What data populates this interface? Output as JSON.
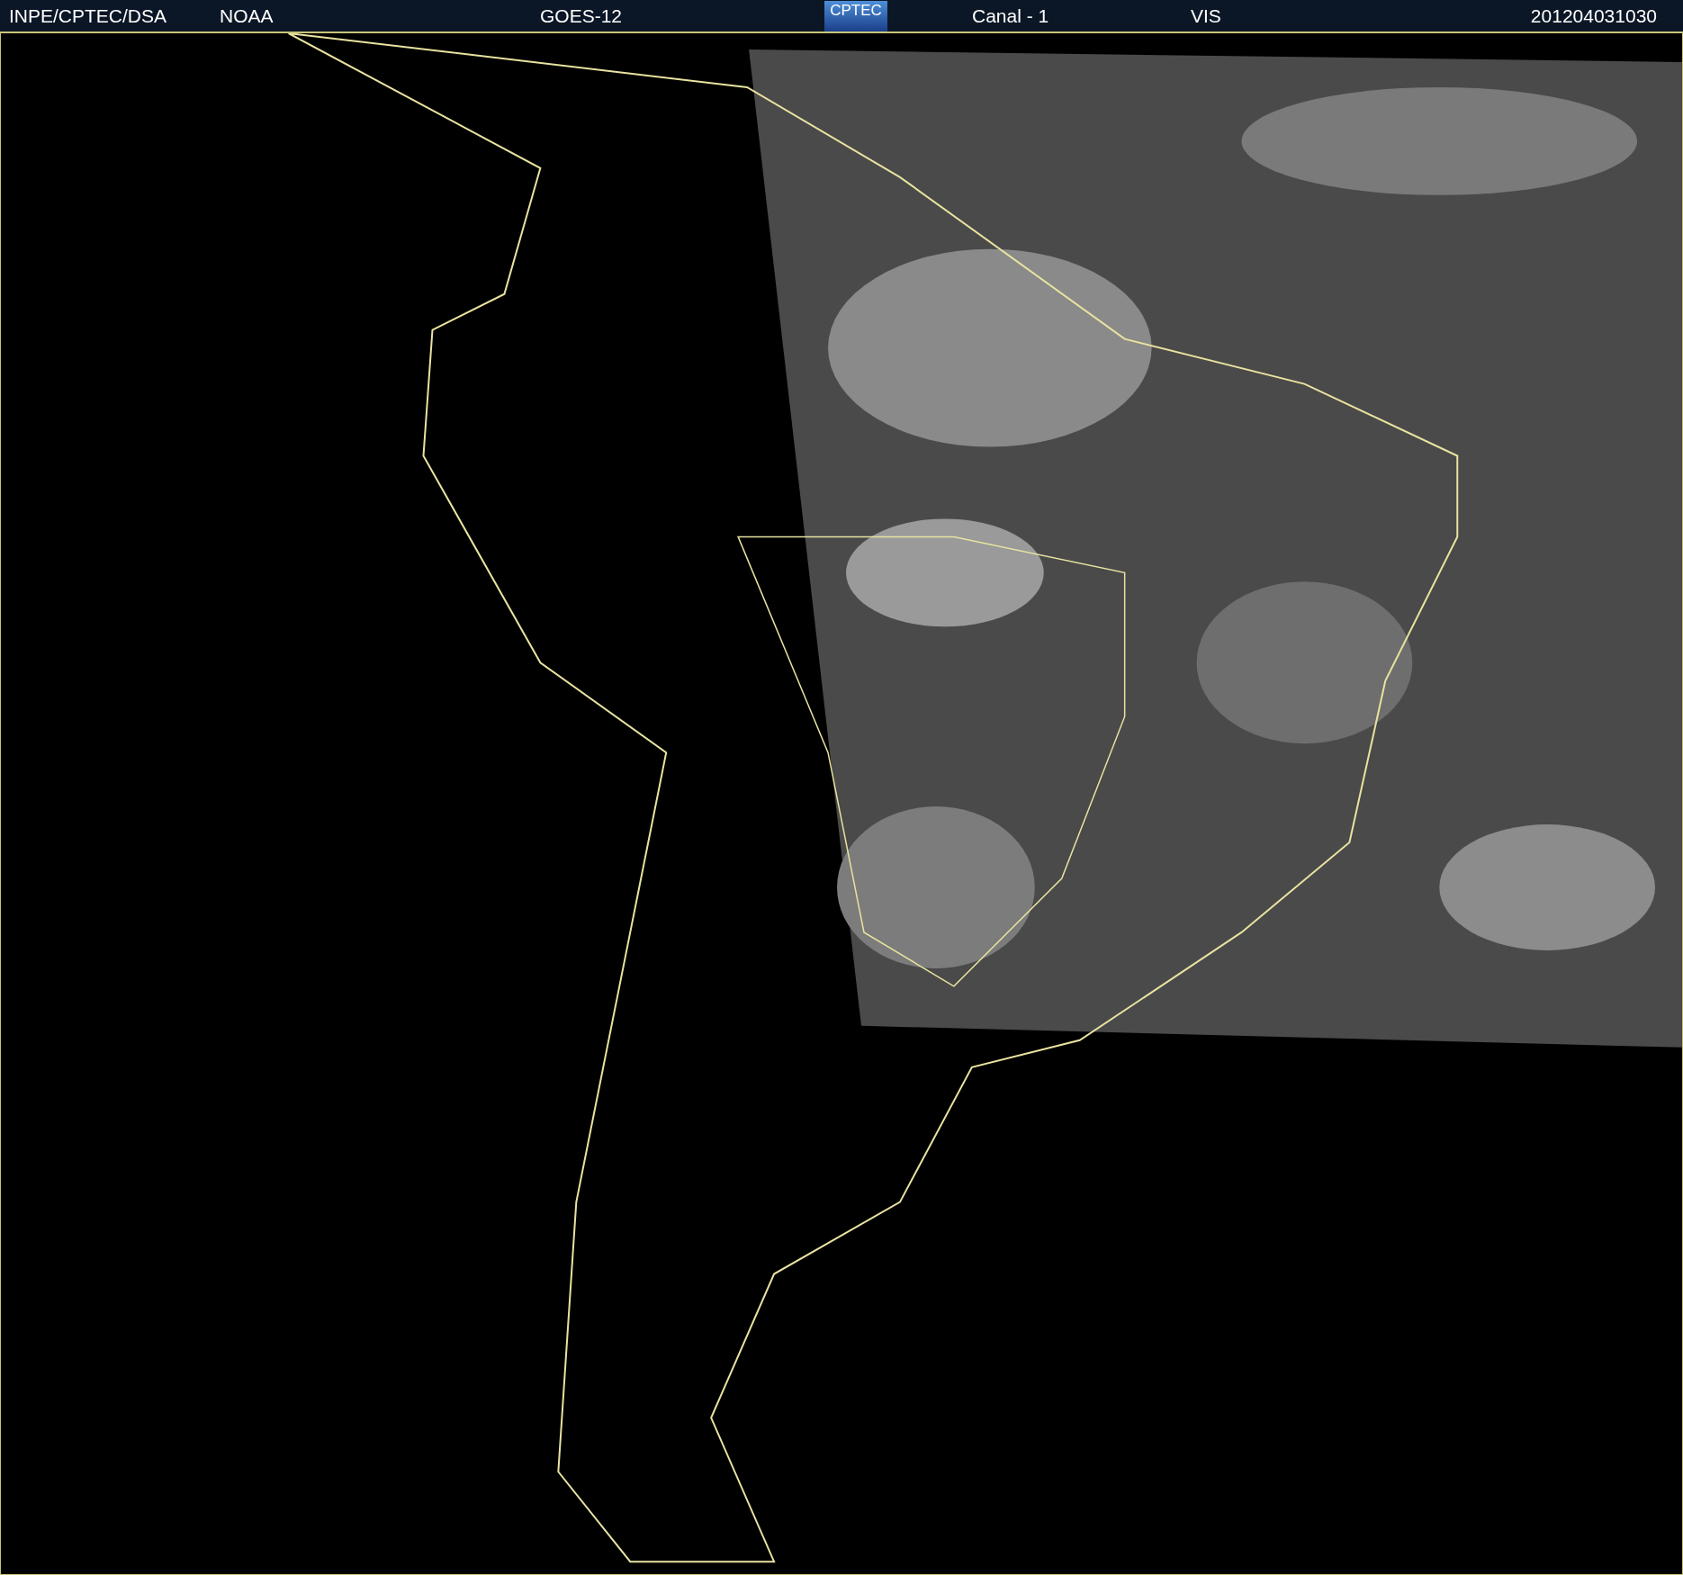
{
  "header": {
    "agency": "INPE/CPTEC/DSA",
    "source": "NOAA",
    "satellite": "GOES-12",
    "logo": "CPTEC",
    "channel": "Canal - 1",
    "band": "VIS",
    "timestamp": "201204031030"
  }
}
